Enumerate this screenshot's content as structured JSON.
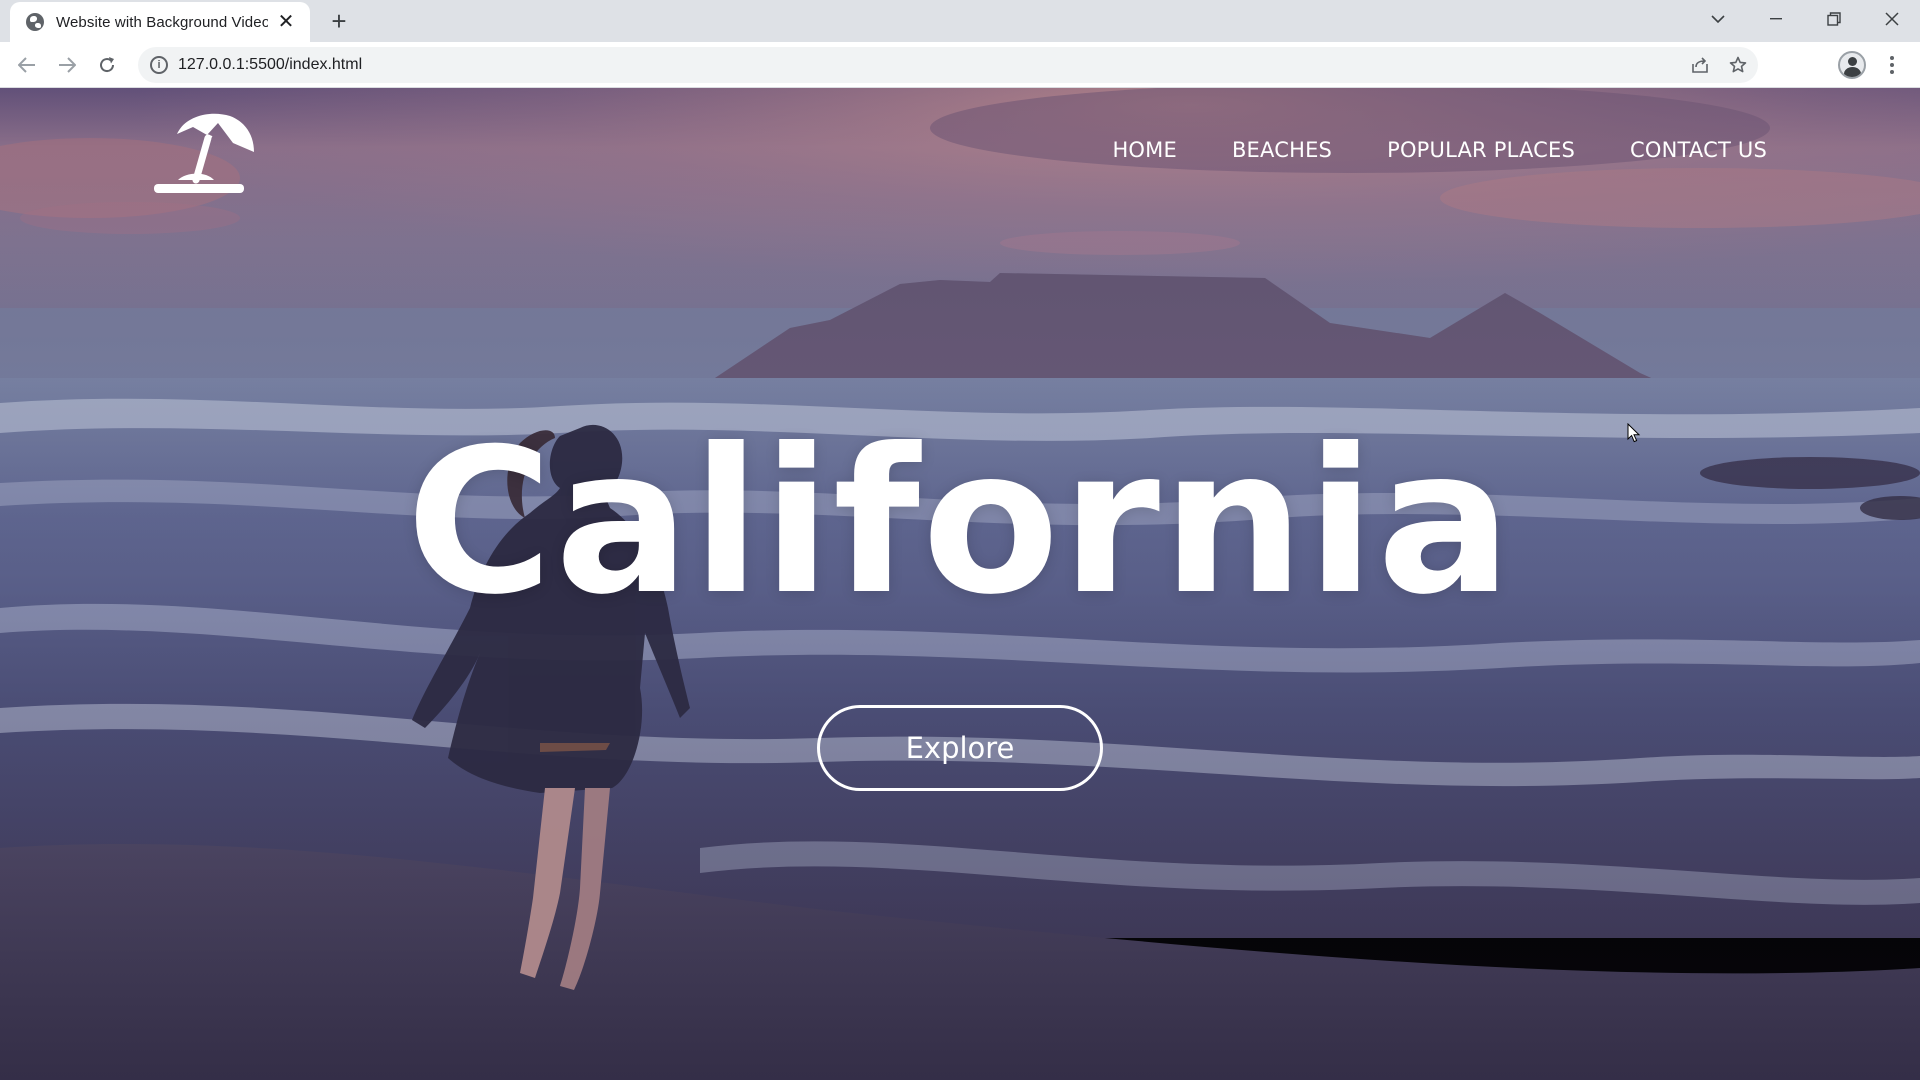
{
  "browser": {
    "tab_title": "Website with Background Video",
    "tab_close_glyph": "✕",
    "new_tab_glyph": "+",
    "url": "127.0.0.1:5500/index.html",
    "icons": {
      "favicon": "globe-icon",
      "back": "arrow-left-icon",
      "forward": "arrow-right-icon",
      "reload": "reload-icon",
      "site_info": "info-icon",
      "share": "share-icon",
      "bookmark": "star-icon",
      "profile": "avatar",
      "menu": "kebab-menu-icon",
      "tab_search": "chevron-down-icon",
      "minimize": "minimize-icon",
      "restore": "restore-icon",
      "close": "close-icon"
    }
  },
  "site": {
    "logo": "beach-umbrella-icon",
    "nav": {
      "home": "HOME",
      "beaches": "BEACHES",
      "popular_places": "POPULAR PLACES",
      "contact_us": "CONTACT US"
    },
    "headline": "California",
    "cta_label": "Explore"
  },
  "colors": {
    "text": "#ffffff",
    "sky_top": "#5b4e78",
    "sky_glow": "#c98a96",
    "sea": "#4a4f76",
    "sand": "#4e4660"
  }
}
